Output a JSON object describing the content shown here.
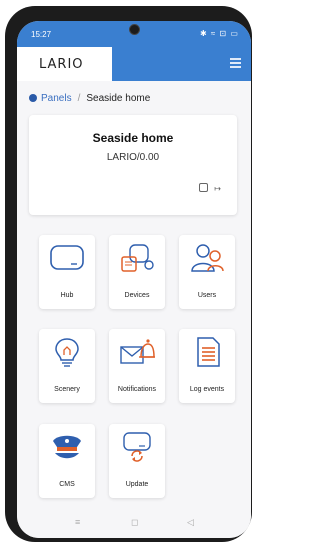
{
  "status": {
    "time": "15:27",
    "icons": "✱ ≈ ⊡ ▭"
  },
  "app": {
    "logo": "LARIO"
  },
  "breadcrumb": {
    "root": "Panels",
    "separator": "/",
    "current": "Seaside home"
  },
  "panel": {
    "title": "Seaside home",
    "subtitle": "LARIO/0.00",
    "action_icon": "logout-icon"
  },
  "tiles": [
    {
      "label": "Hub",
      "icon": "hub-icon"
    },
    {
      "label": "Devices",
      "icon": "devices-icon"
    },
    {
      "label": "Users",
      "icon": "users-icon"
    },
    {
      "label": "Scenery",
      "icon": "lightbulb-icon"
    },
    {
      "label": "Notifications",
      "icon": "notifications-icon"
    },
    {
      "label": "Log events",
      "icon": "log-events-icon"
    },
    {
      "label": "CMS",
      "icon": "police-hat-icon"
    },
    {
      "label": "Update",
      "icon": "update-icon"
    }
  ],
  "nav": {
    "menu": "≡",
    "home": "◻",
    "back": "◁"
  },
  "colors": {
    "accent": "#3a7fd0",
    "icon_blue": "#2f5fae",
    "icon_orange": "#e0612a"
  }
}
